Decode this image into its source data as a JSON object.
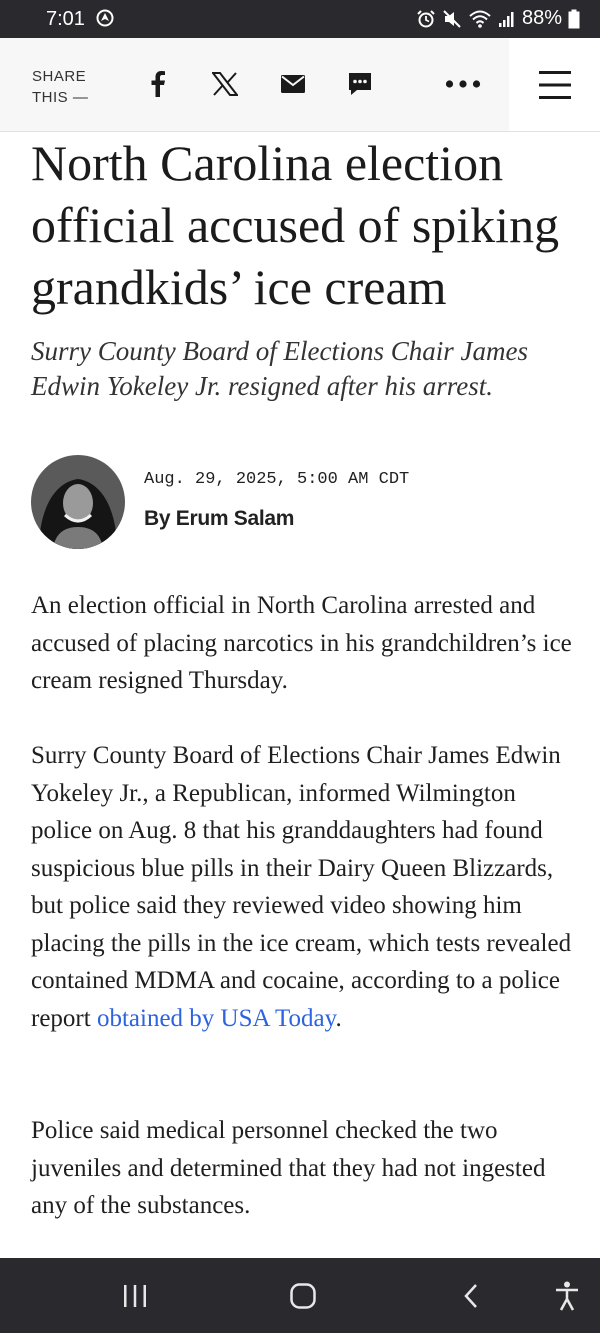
{
  "status_bar": {
    "time": "7:01",
    "battery": "88%"
  },
  "share_bar": {
    "label": "SHARE THIS —",
    "icons": [
      "facebook-icon",
      "x-icon",
      "email-icon",
      "comment-icon",
      "more-icon",
      "menu-icon"
    ]
  },
  "article": {
    "headline": "North Carolina election official accused of spiking grandkids’ ice cream",
    "dek": "Surry County Board of Elections Chair James Edwin Yokeley Jr. resigned after his arrest.",
    "date": "Aug. 29, 2025, 5:00 AM CDT",
    "author": "By Erum Salam",
    "paragraph1": "An election official in North Carolina arrested and accused of placing narcotics in his grandchildren’s ice cream resigned Thursday.",
    "paragraph2_before_link": "Surry County Board of Elections Chair James Edwin Yokeley Jr., a Republican, informed Wilmington police on Aug. 8 that his granddaughters had found suspicious blue pills in their Dairy Queen Blizzards, but police said they reviewed video showing him placing the pills in the ice cream, which tests revealed contained MDMA and cocaine, according to a police report ",
    "paragraph2_link": "obtained by USA Today",
    "paragraph2_after_link": ".",
    "paragraph3": "Police said medical personnel checked the two juveniles and determined that they had not ingested any of the substances."
  },
  "colors": {
    "link": "#2b63e0",
    "system_bar": "#2a2a2e"
  }
}
